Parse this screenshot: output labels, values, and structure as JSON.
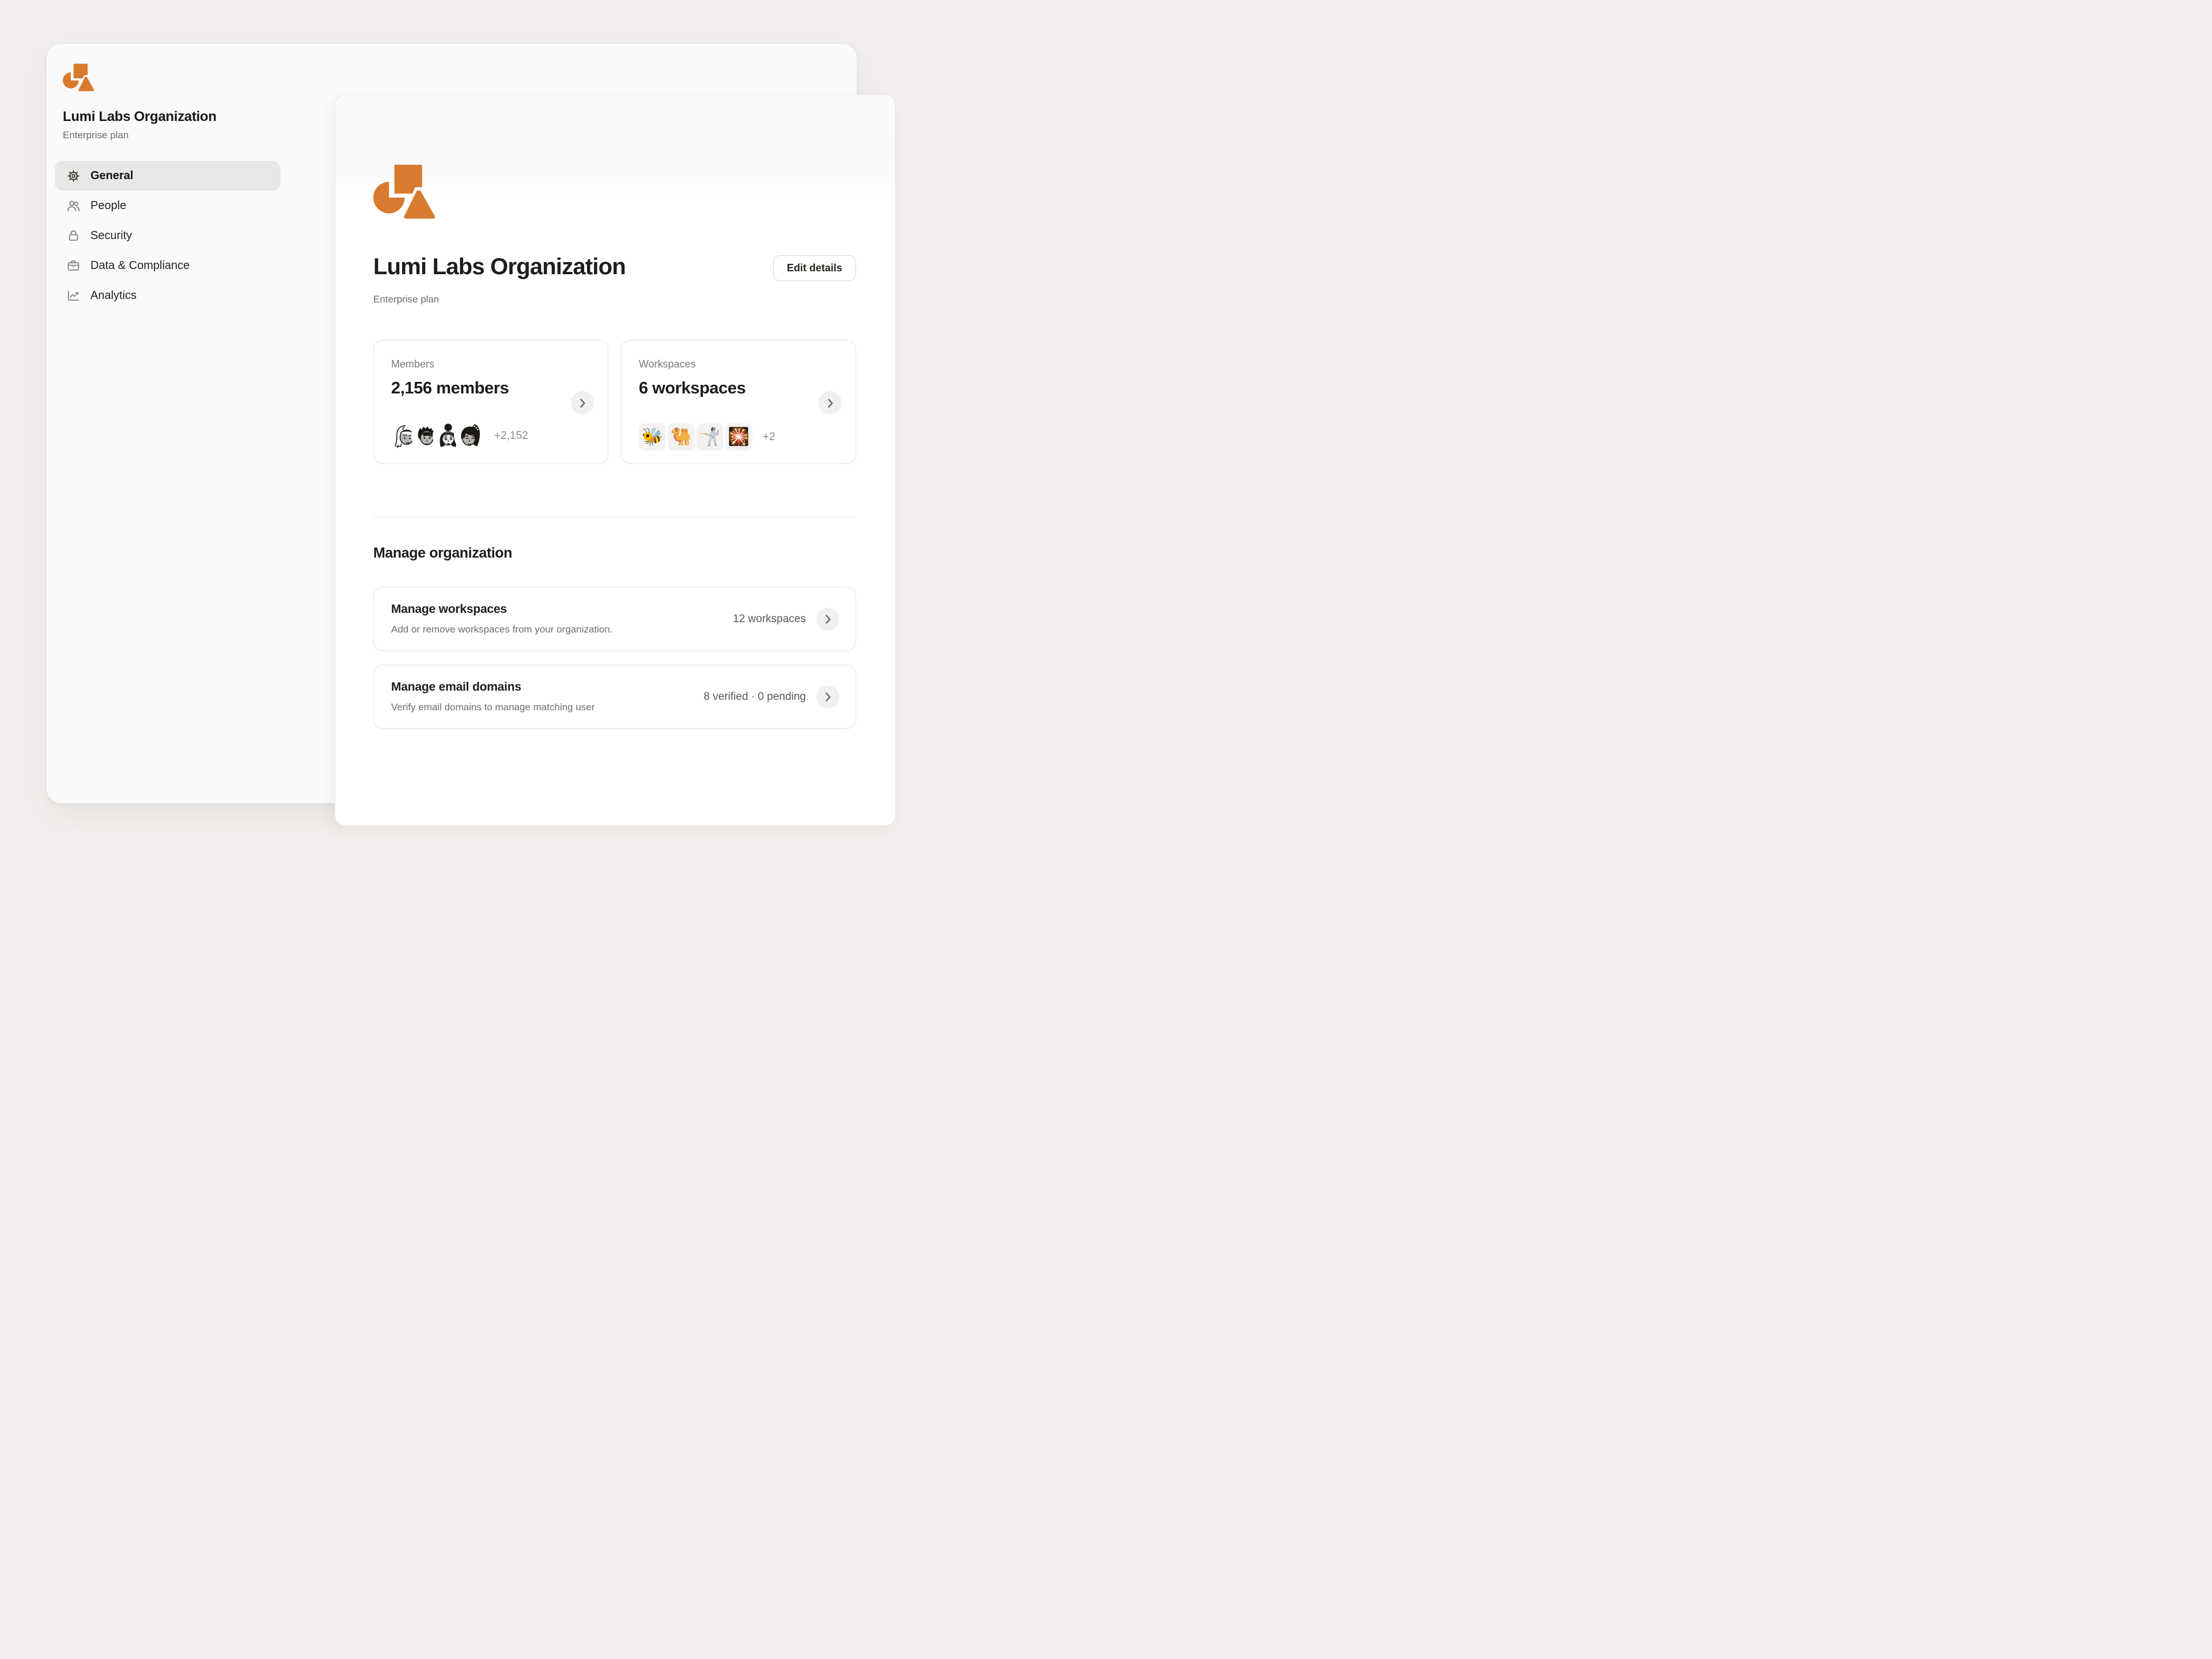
{
  "sidebar": {
    "org_name": "Lumi Labs Organization",
    "plan": "Enterprise plan",
    "nav": [
      {
        "label": "General",
        "icon": "gear-icon",
        "active": true
      },
      {
        "label": "People",
        "icon": "people-icon",
        "active": false
      },
      {
        "label": "Security",
        "icon": "lock-icon",
        "active": false
      },
      {
        "label": "Data & Compliance",
        "icon": "briefcase-icon",
        "active": false
      },
      {
        "label": "Analytics",
        "icon": "chart-icon",
        "active": false
      }
    ]
  },
  "main": {
    "title": "Lumi Labs Organization",
    "plan": "Enterprise plan",
    "edit_button": "Edit details",
    "stats": {
      "members": {
        "label": "Members",
        "value": "2,156 members",
        "more": "+2,152",
        "avatars": [
          "woman-light-hair",
          "man-spiky-hair",
          "woman-bun",
          "woman-ponytail"
        ]
      },
      "workspaces": {
        "label": "Workspaces",
        "value": "6 workspaces",
        "more": "+2",
        "emojis": [
          "🐝",
          "🐫",
          "🤺",
          "🎇"
        ]
      }
    },
    "manage": {
      "heading": "Manage organization",
      "rows": [
        {
          "title": "Manage workspaces",
          "description": "Add or remove workspaces from your organization.",
          "meta": "12 workspaces"
        },
        {
          "title": "Manage email domains",
          "description": "Verify email domains to manage matching user",
          "meta": "8 verified · 0 pending"
        }
      ]
    }
  },
  "colors": {
    "accent": "#d97b2e",
    "window_bg": "#fbfafa",
    "page_bg": "#f2efee"
  }
}
